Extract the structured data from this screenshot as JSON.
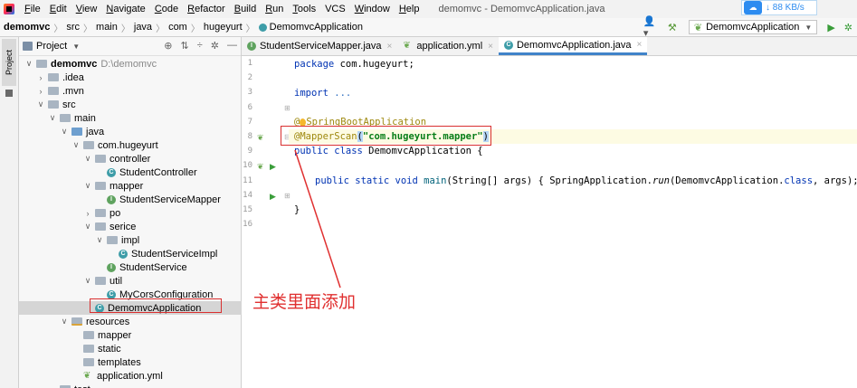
{
  "menu": {
    "items": [
      {
        "u": "F",
        "rest": "ile"
      },
      {
        "u": "E",
        "rest": "dit"
      },
      {
        "u": "V",
        "rest": "iew"
      },
      {
        "u": "N",
        "rest": "avigate"
      },
      {
        "u": "C",
        "rest": "ode"
      },
      {
        "u": "R",
        "rest": "efactor"
      },
      {
        "u": "B",
        "rest": "uild"
      },
      {
        "u": "R",
        "rest": "un"
      },
      {
        "u": "T",
        "rest": "ools"
      },
      {
        "u": "",
        "rest": "VCS"
      },
      {
        "u": "W",
        "rest": "indow"
      },
      {
        "u": "H",
        "rest": "elp"
      }
    ],
    "window_title": "demomvc - DemomvcApplication.java",
    "net_speed": "↓ 88 KB/s"
  },
  "nav": {
    "crumbs": [
      "demomvc",
      "src",
      "main",
      "java",
      "com",
      "hugeyurt",
      "DemomvcApplication"
    ],
    "run_config": "DemomvcApplication"
  },
  "sidebar": {
    "tab_label": "Project"
  },
  "project": {
    "title": "Project",
    "tree": [
      {
        "label": "demomvc",
        "extra": "D:\\demomvc",
        "indent": 0,
        "chev": "v",
        "icon": "folder",
        "bold": true
      },
      {
        "label": ".idea",
        "indent": 1,
        "chev": ">",
        "icon": "folder"
      },
      {
        "label": ".mvn",
        "indent": 1,
        "chev": ">",
        "icon": "folder"
      },
      {
        "label": "src",
        "indent": 1,
        "chev": "v",
        "icon": "folder"
      },
      {
        "label": "main",
        "indent": 2,
        "chev": "v",
        "icon": "folder"
      },
      {
        "label": "java",
        "indent": 3,
        "chev": "v",
        "icon": "folder-blue"
      },
      {
        "label": "com.hugeyurt",
        "indent": 4,
        "chev": "v",
        "icon": "folder"
      },
      {
        "label": "controller",
        "indent": 5,
        "chev": "v",
        "icon": "folder"
      },
      {
        "label": "StudentController",
        "indent": 6,
        "chev": "",
        "icon": "class"
      },
      {
        "label": "mapper",
        "indent": 5,
        "chev": "v",
        "icon": "folder"
      },
      {
        "label": "StudentServiceMapper",
        "indent": 6,
        "chev": "",
        "icon": "interface"
      },
      {
        "label": "po",
        "indent": 5,
        "chev": ">",
        "icon": "folder"
      },
      {
        "label": "serice",
        "indent": 5,
        "chev": "v",
        "icon": "folder"
      },
      {
        "label": "impl",
        "indent": 6,
        "chev": "v",
        "icon": "folder"
      },
      {
        "label": "StudentServiceImpl",
        "indent": 7,
        "chev": "",
        "icon": "class"
      },
      {
        "label": "StudentService",
        "indent": 6,
        "chev": "",
        "icon": "interface"
      },
      {
        "label": "util",
        "indent": 5,
        "chev": "v",
        "icon": "folder"
      },
      {
        "label": "MyCorsConfiguration",
        "indent": 6,
        "chev": "",
        "icon": "class"
      },
      {
        "label": "DemomvcApplication",
        "indent": 5,
        "chev": "",
        "icon": "class",
        "selected": true
      },
      {
        "label": "resources",
        "indent": 3,
        "chev": "v",
        "icon": "folder-res"
      },
      {
        "label": "mapper",
        "indent": 4,
        "chev": "",
        "icon": "folder"
      },
      {
        "label": "static",
        "indent": 4,
        "chev": "",
        "icon": "folder"
      },
      {
        "label": "templates",
        "indent": 4,
        "chev": "",
        "icon": "folder"
      },
      {
        "label": "application.yml",
        "indent": 4,
        "chev": "",
        "icon": "yml"
      },
      {
        "label": "test",
        "indent": 2,
        "chev": ">",
        "icon": "folder"
      }
    ]
  },
  "editor": {
    "tabs": [
      {
        "label": "StudentServiceMapper.java",
        "icon": "interface",
        "active": false
      },
      {
        "label": "application.yml",
        "icon": "yml",
        "active": false
      },
      {
        "label": "DemomvcApplication.java",
        "icon": "class",
        "active": true
      }
    ],
    "line_numbers": [
      "1",
      "2",
      "3",
      "6",
      "7",
      "8",
      "9",
      "10",
      "11",
      "14",
      "15",
      "16"
    ],
    "code": {
      "l1_kw": "package",
      "l1_rest": " com.hugeyurt;",
      "l3_kw": "import",
      "l3_fold": " ...",
      "l7_at": "@",
      "l7_name": "SpringBootApplication",
      "l8_ann": "@MapperScan",
      "l8_open": "(",
      "l8_str": "\"com.hugeyurt.mapper\"",
      "l8_close": ")",
      "l9_kw": "public class",
      "l9_rest": " DemomvcApplication {",
      "l11_kw": "public static void",
      "l11_fn": " main",
      "l11_args": "(String[] args) ",
      "l11_body1": "{ SpringApplication.",
      "l11_run": "run",
      "l11_body2": "(DemomvcApplication.",
      "l11_class": "class",
      "l11_body3": ", args); }",
      "l15": "}"
    }
  },
  "annotation": {
    "text": "主类里面添加"
  }
}
